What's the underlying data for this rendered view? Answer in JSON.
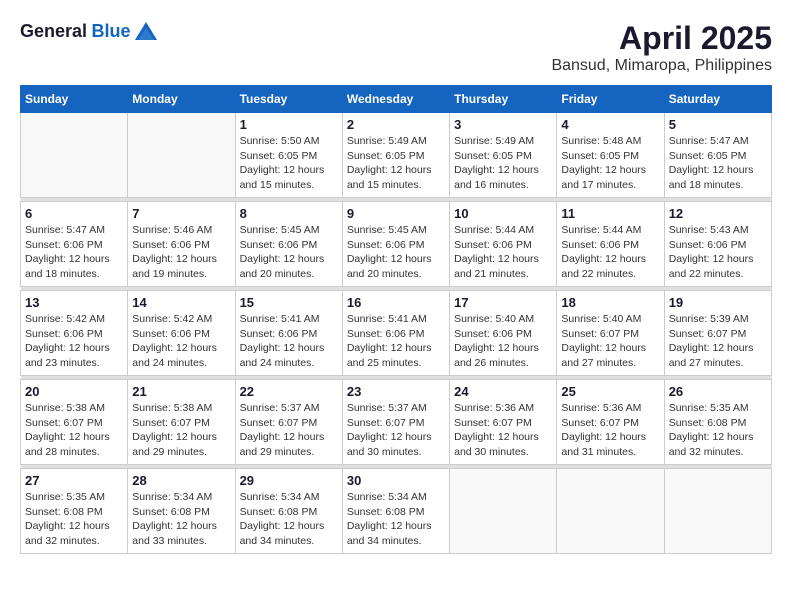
{
  "header": {
    "logo_general": "General",
    "logo_blue": "Blue",
    "month_title": "April 2025",
    "location": "Bansud, Mimaropa, Philippines"
  },
  "weekdays": [
    "Sunday",
    "Monday",
    "Tuesday",
    "Wednesday",
    "Thursday",
    "Friday",
    "Saturday"
  ],
  "weeks": [
    [
      {
        "day": "",
        "info": ""
      },
      {
        "day": "",
        "info": ""
      },
      {
        "day": "1",
        "info": "Sunrise: 5:50 AM\nSunset: 6:05 PM\nDaylight: 12 hours and 15 minutes."
      },
      {
        "day": "2",
        "info": "Sunrise: 5:49 AM\nSunset: 6:05 PM\nDaylight: 12 hours and 15 minutes."
      },
      {
        "day": "3",
        "info": "Sunrise: 5:49 AM\nSunset: 6:05 PM\nDaylight: 12 hours and 16 minutes."
      },
      {
        "day": "4",
        "info": "Sunrise: 5:48 AM\nSunset: 6:05 PM\nDaylight: 12 hours and 17 minutes."
      },
      {
        "day": "5",
        "info": "Sunrise: 5:47 AM\nSunset: 6:05 PM\nDaylight: 12 hours and 18 minutes."
      }
    ],
    [
      {
        "day": "6",
        "info": "Sunrise: 5:47 AM\nSunset: 6:06 PM\nDaylight: 12 hours and 18 minutes."
      },
      {
        "day": "7",
        "info": "Sunrise: 5:46 AM\nSunset: 6:06 PM\nDaylight: 12 hours and 19 minutes."
      },
      {
        "day": "8",
        "info": "Sunrise: 5:45 AM\nSunset: 6:06 PM\nDaylight: 12 hours and 20 minutes."
      },
      {
        "day": "9",
        "info": "Sunrise: 5:45 AM\nSunset: 6:06 PM\nDaylight: 12 hours and 20 minutes."
      },
      {
        "day": "10",
        "info": "Sunrise: 5:44 AM\nSunset: 6:06 PM\nDaylight: 12 hours and 21 minutes."
      },
      {
        "day": "11",
        "info": "Sunrise: 5:44 AM\nSunset: 6:06 PM\nDaylight: 12 hours and 22 minutes."
      },
      {
        "day": "12",
        "info": "Sunrise: 5:43 AM\nSunset: 6:06 PM\nDaylight: 12 hours and 22 minutes."
      }
    ],
    [
      {
        "day": "13",
        "info": "Sunrise: 5:42 AM\nSunset: 6:06 PM\nDaylight: 12 hours and 23 minutes."
      },
      {
        "day": "14",
        "info": "Sunrise: 5:42 AM\nSunset: 6:06 PM\nDaylight: 12 hours and 24 minutes."
      },
      {
        "day": "15",
        "info": "Sunrise: 5:41 AM\nSunset: 6:06 PM\nDaylight: 12 hours and 24 minutes."
      },
      {
        "day": "16",
        "info": "Sunrise: 5:41 AM\nSunset: 6:06 PM\nDaylight: 12 hours and 25 minutes."
      },
      {
        "day": "17",
        "info": "Sunrise: 5:40 AM\nSunset: 6:06 PM\nDaylight: 12 hours and 26 minutes."
      },
      {
        "day": "18",
        "info": "Sunrise: 5:40 AM\nSunset: 6:07 PM\nDaylight: 12 hours and 27 minutes."
      },
      {
        "day": "19",
        "info": "Sunrise: 5:39 AM\nSunset: 6:07 PM\nDaylight: 12 hours and 27 minutes."
      }
    ],
    [
      {
        "day": "20",
        "info": "Sunrise: 5:38 AM\nSunset: 6:07 PM\nDaylight: 12 hours and 28 minutes."
      },
      {
        "day": "21",
        "info": "Sunrise: 5:38 AM\nSunset: 6:07 PM\nDaylight: 12 hours and 29 minutes."
      },
      {
        "day": "22",
        "info": "Sunrise: 5:37 AM\nSunset: 6:07 PM\nDaylight: 12 hours and 29 minutes."
      },
      {
        "day": "23",
        "info": "Sunrise: 5:37 AM\nSunset: 6:07 PM\nDaylight: 12 hours and 30 minutes."
      },
      {
        "day": "24",
        "info": "Sunrise: 5:36 AM\nSunset: 6:07 PM\nDaylight: 12 hours and 30 minutes."
      },
      {
        "day": "25",
        "info": "Sunrise: 5:36 AM\nSunset: 6:07 PM\nDaylight: 12 hours and 31 minutes."
      },
      {
        "day": "26",
        "info": "Sunrise: 5:35 AM\nSunset: 6:08 PM\nDaylight: 12 hours and 32 minutes."
      }
    ],
    [
      {
        "day": "27",
        "info": "Sunrise: 5:35 AM\nSunset: 6:08 PM\nDaylight: 12 hours and 32 minutes."
      },
      {
        "day": "28",
        "info": "Sunrise: 5:34 AM\nSunset: 6:08 PM\nDaylight: 12 hours and 33 minutes."
      },
      {
        "day": "29",
        "info": "Sunrise: 5:34 AM\nSunset: 6:08 PM\nDaylight: 12 hours and 34 minutes."
      },
      {
        "day": "30",
        "info": "Sunrise: 5:34 AM\nSunset: 6:08 PM\nDaylight: 12 hours and 34 minutes."
      },
      {
        "day": "",
        "info": ""
      },
      {
        "day": "",
        "info": ""
      },
      {
        "day": "",
        "info": ""
      }
    ]
  ]
}
